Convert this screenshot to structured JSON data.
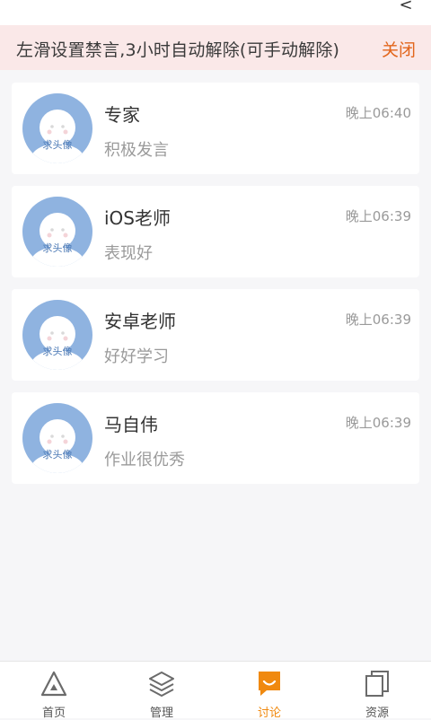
{
  "header": {
    "back_glyph": "<"
  },
  "notice": {
    "text": "左滑设置禁言,3小时自动解除(可手动解除)",
    "close_label": "关闭"
  },
  "conversations": [
    {
      "name": "专家",
      "message": "积极发言",
      "time": "晚上06:40",
      "avatar_label": "求头像"
    },
    {
      "name": "iOS老师",
      "message": "表现好",
      "time": "晚上06:39",
      "avatar_label": "求头像"
    },
    {
      "name": "安卓老师",
      "message": "好好学习",
      "time": "晚上06:39",
      "avatar_label": "求头像"
    },
    {
      "name": "马自伟",
      "message": "作业很优秀",
      "time": "晚上06:39",
      "avatar_label": "求头像"
    }
  ],
  "tabs": [
    {
      "label": "首页",
      "icon": "triangle-icon",
      "active": false
    },
    {
      "label": "管理",
      "icon": "layers-icon",
      "active": false
    },
    {
      "label": "讨论",
      "icon": "chat-bubble-icon",
      "active": true
    },
    {
      "label": "资源",
      "icon": "files-icon",
      "active": false
    }
  ],
  "colors": {
    "accent": "#f0890f",
    "notice_bg": "#fae8e8",
    "close": "#e2651b",
    "avatar": "#8fb3e0"
  }
}
